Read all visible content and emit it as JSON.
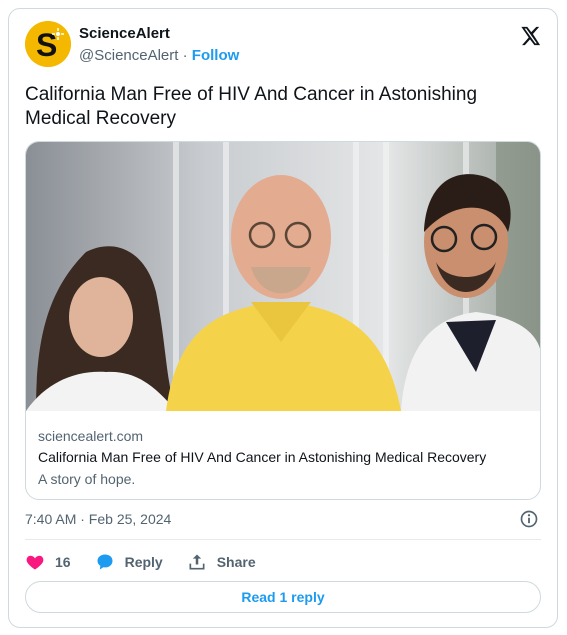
{
  "author": {
    "name": "ScienceAlert",
    "handle": "@ScienceAlert",
    "separator": "·",
    "follow_label": "Follow",
    "avatar_letter": "S"
  },
  "tweet": {
    "text": "California Man Free of HIV And Cancer in Astonishing Medical Recovery"
  },
  "link_card": {
    "domain": "sciencealert.com",
    "title": "California Man Free of HIV And Cancer in Astonishing Medical Recovery",
    "description": "A story of hope."
  },
  "meta": {
    "timestamp": "7:40 AM · Feb 25, 2024"
  },
  "actions": {
    "like_count": "16",
    "reply_label": "Reply",
    "share_label": "Share",
    "read_replies_label": "Read 1 reply"
  },
  "colors": {
    "accent": "#1d9bf0",
    "like": "#f91880",
    "avatar_bg": "#f5b800"
  },
  "icons": [
    "x-logo-icon",
    "info-icon",
    "heart-icon",
    "reply-bubble-icon",
    "share-icon"
  ]
}
